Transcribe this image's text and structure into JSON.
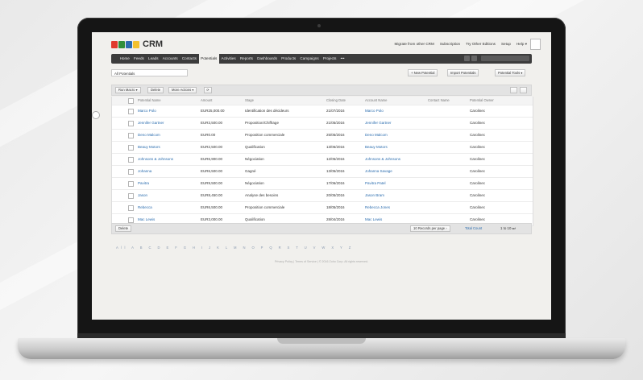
{
  "app": {
    "name": "CRM",
    "logo_colors": [
      "#e03b2e",
      "#2f8f3a",
      "#2a6cae",
      "#f2c12e"
    ]
  },
  "top_links": [
    "Migrate from other CRM",
    "Subscription",
    "Try Other Editions",
    "Setup",
    "Help ▾"
  ],
  "nav": {
    "items": [
      "Home",
      "Feeds",
      "Leads",
      "Accounts",
      "Contacts",
      "Potentials",
      "Activities",
      "Reports",
      "Dashboards",
      "Products",
      "Campaigns",
      "Projects",
      "•••"
    ],
    "active": "Potentials"
  },
  "filter": {
    "view_label": "All Potentials",
    "new_button": "+ New Potential",
    "import_button": "Import Potentials",
    "tools_button": "Potential Tools ▾"
  },
  "toolbar": {
    "run_macro": "Run Macro ▾",
    "delete": "Delete",
    "more_actions": "More Actions ▾",
    "refresh_icon": "refresh-icon"
  },
  "table": {
    "columns": [
      "Potential Name",
      "Amount",
      "Stage",
      "Closing Date",
      "Account Name",
      "Contact Name",
      "Potential Owner"
    ],
    "rows": [
      {
        "name": "Marco Polo",
        "amount": "EUR25,000.00",
        "stage": "Identification des décideurs",
        "closing": "21/07/2016",
        "account": "Marco Polo",
        "contact": "",
        "owner": "Carolinec"
      },
      {
        "name": "Jennifer Gartner",
        "amount": "EUR3,500.00",
        "stage": "Proposition/Chiffrage",
        "closing": "21/05/2016",
        "account": "Jennifer Gartner",
        "contact": "",
        "owner": "Carolinec"
      },
      {
        "name": "Deno Malcom",
        "amount": "EUR0.00",
        "stage": "Proposition commerciale",
        "closing": "25/05/2016",
        "account": "Deno Malcom",
        "contact": "",
        "owner": "Carolinec"
      },
      {
        "name": "Beauy Motors",
        "amount": "EUR2,500.00",
        "stage": "Qualification",
        "closing": "13/06/2016",
        "account": "Beauy Motors",
        "contact": "",
        "owner": "Carolinec"
      },
      {
        "name": "Johnsons & Johnsons",
        "amount": "EUR6,900.00",
        "stage": "Négociation",
        "closing": "12/05/2016",
        "account": "Johnsons & Johnsons",
        "contact": "",
        "owner": "Carolinec"
      },
      {
        "name": "Johanna",
        "amount": "EUR6,500.00",
        "stage": "Gagné",
        "closing": "13/05/2016",
        "account": "Johanna Savage",
        "contact": "",
        "owner": "Carolinec"
      },
      {
        "name": "Pavitra",
        "amount": "EUR9,500.00",
        "stage": "Négociation",
        "closing": "17/06/2016",
        "account": "Pavitra Patel",
        "contact": "",
        "owner": "Carolinec"
      },
      {
        "name": "Jason",
        "amount": "EUR8,450.00",
        "stage": "Analyse des besoins",
        "closing": "20/05/2016",
        "account": "Jason Bram",
        "contact": "",
        "owner": "Carolinec"
      },
      {
        "name": "Rebecca",
        "amount": "EUR6,500.00",
        "stage": "Proposition commerciale",
        "closing": "18/05/2016",
        "account": "Rebecca Jones",
        "contact": "",
        "owner": "Carolinec"
      },
      {
        "name": "Mac Lewis",
        "amount": "EUR3,000.00",
        "stage": "Qualification",
        "closing": "28/04/2016",
        "account": "Mac Lewis",
        "contact": "",
        "owner": "Carolinec"
      }
    ]
  },
  "footer": {
    "delete": "Delete",
    "per_page": "10 Records per page ›",
    "total_count": "Total Count",
    "range": "1 to 10 ⏭"
  },
  "alphabet": "All A B C D E F G H I J K L M N O P Q R S T U V W X Y Z",
  "copyright": "Privacy Policy | Terms of Service | © 2016 Zoho Corp. All rights reserved."
}
